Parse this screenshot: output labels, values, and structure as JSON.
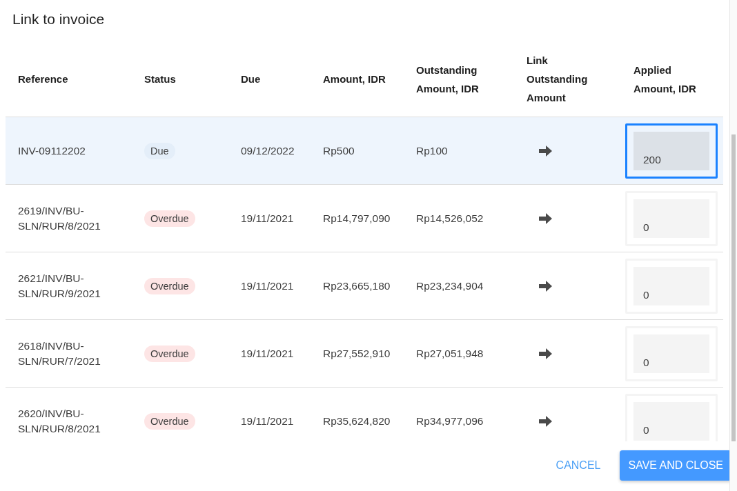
{
  "dialog": {
    "title": "Link to invoice"
  },
  "table": {
    "columns": [
      {
        "label": "Reference"
      },
      {
        "label": "Status"
      },
      {
        "label": "Due"
      },
      {
        "label": "Amount, IDR"
      },
      {
        "label": "Outstanding Amount, IDR"
      },
      {
        "label": "Link Outstanding Amount"
      },
      {
        "label": "Applied Amount, IDR"
      }
    ],
    "rows": [
      {
        "reference": "INV-09112202",
        "status": {
          "label": "Due",
          "kind": "due"
        },
        "due": "09/12/2022",
        "amount": "Rp500",
        "outstanding": "Rp100",
        "applied": {
          "value": "200",
          "focused": true
        },
        "selected": true
      },
      {
        "reference": "2619/INV/BU-SLN/RUR/8/2021",
        "status": {
          "label": "Overdue",
          "kind": "overdue"
        },
        "due": "19/11/2021",
        "amount": "Rp14,797,090",
        "outstanding": "Rp14,526,052",
        "applied": {
          "value": "0",
          "focused": false
        },
        "selected": false
      },
      {
        "reference": "2621/INV/BU-SLN/RUR/9/2021",
        "status": {
          "label": "Overdue",
          "kind": "overdue"
        },
        "due": "19/11/2021",
        "amount": "Rp23,665,180",
        "outstanding": "Rp23,234,904",
        "applied": {
          "value": "0",
          "focused": false
        },
        "selected": false
      },
      {
        "reference": "2618/INV/BU-SLN/RUR/7/2021",
        "status": {
          "label": "Overdue",
          "kind": "overdue"
        },
        "due": "19/11/2021",
        "amount": "Rp27,552,910",
        "outstanding": "Rp27,051,948",
        "applied": {
          "value": "0",
          "focused": false
        },
        "selected": false
      },
      {
        "reference": "2620/INV/BU-SLN/RUR/8/2021",
        "status": {
          "label": "Overdue",
          "kind": "overdue"
        },
        "due": "19/11/2021",
        "amount": "Rp35,624,820",
        "outstanding": "Rp34,977,096",
        "applied": {
          "value": "0",
          "focused": false
        },
        "selected": false
      }
    ]
  },
  "buttons": [
    {
      "label": "CANCEL",
      "kind": "text"
    },
    {
      "label": "SAVE AND CLOSE",
      "kind": "primary"
    }
  ]
}
